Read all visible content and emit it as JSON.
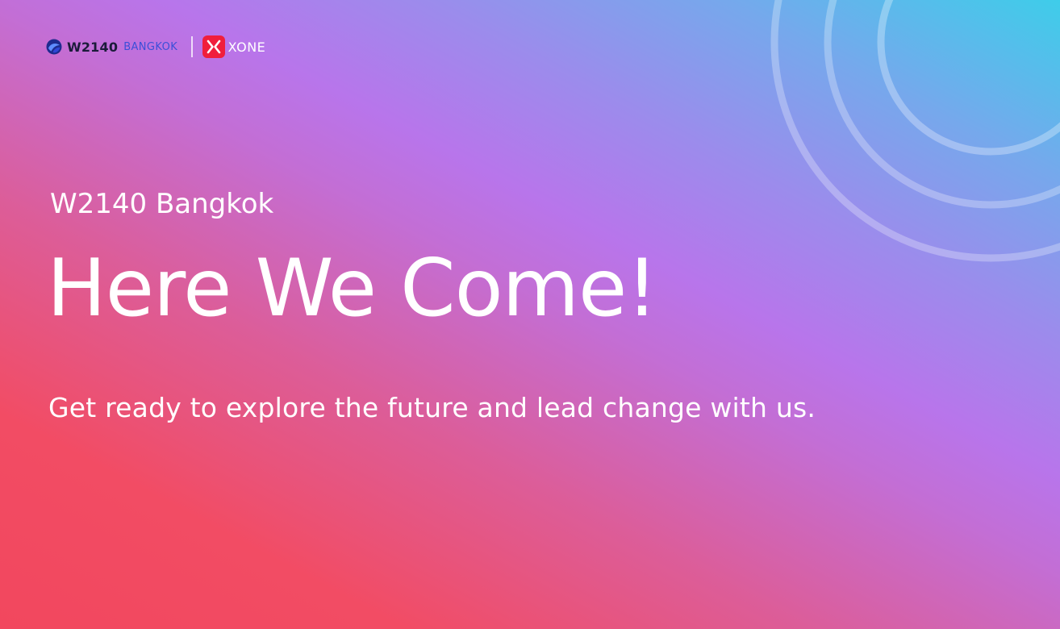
{
  "logos": {
    "w2140_name": "W2140",
    "w2140_city": "BANGKOK",
    "xone_name": "XONE"
  },
  "hero": {
    "eyebrow": "W2140 Bangkok",
    "headline": "Here We Come!",
    "tagline": "Get ready to explore the future and lead change with us."
  },
  "colors": {
    "gradient_start": "#f2475e",
    "gradient_mid": "#b875eb",
    "gradient_end": "#3ecdea",
    "text": "#ffffff",
    "w2140_name": "#1b1b3a",
    "w2140_city": "#3c4fd8",
    "xone_mark": "#f01e3c"
  },
  "icons": [
    "w2140-logo-icon",
    "xone-logo-icon",
    "concentric-rings-decoration"
  ]
}
